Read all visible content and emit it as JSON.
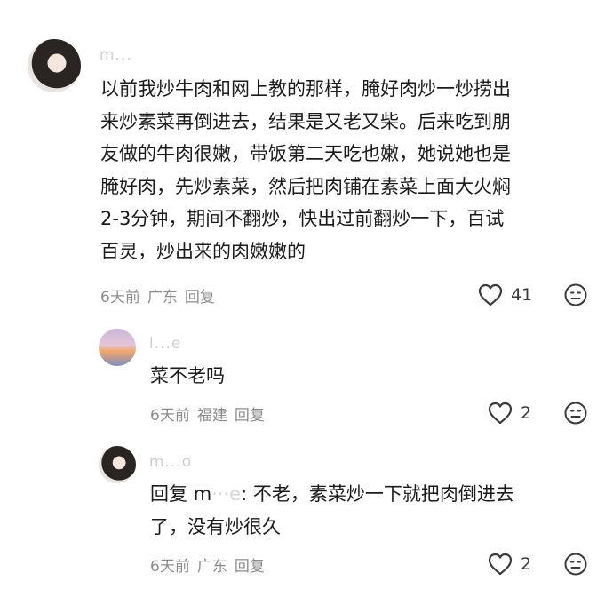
{
  "comments": [
    {
      "username": "m...",
      "text_lines": [
        "以前我炒牛肉和网上教的那样，腌好肉炒一炒捞出",
        "来炒素菜再倒进去，结果是又老又柴。后来吃到朋",
        "友做的牛肉很嫩，带饭第二天吃也嫩，她说她也是",
        "腌好肉，先炒素菜，然后把肉铺在素菜上面大火焖",
        "2-3分钟，期间不翻炒，快出过前翻炒一下，百试",
        "百灵，炒出来的肉嫩嫩的"
      ],
      "time": "6天前",
      "location": "广东",
      "reply_label": "回复",
      "likes": "41"
    },
    {
      "username": "l...e",
      "text": "菜不老吗",
      "time": "6天前",
      "location": "福建",
      "reply_label": "回复",
      "likes": "2"
    },
    {
      "username": "m...o",
      "prefix": "回复",
      "mention": "m",
      "mention_blur": "···e",
      "text_line1": ": 不老，素菜炒一下就把肉倒进去",
      "text_line2": "了，没有炒很久",
      "time": "6天前",
      "location": "广东",
      "reply_label": "回复",
      "likes": "2"
    }
  ],
  "icons": {
    "like": "heart-outline-icon",
    "dislike": "frown-face-icon"
  }
}
